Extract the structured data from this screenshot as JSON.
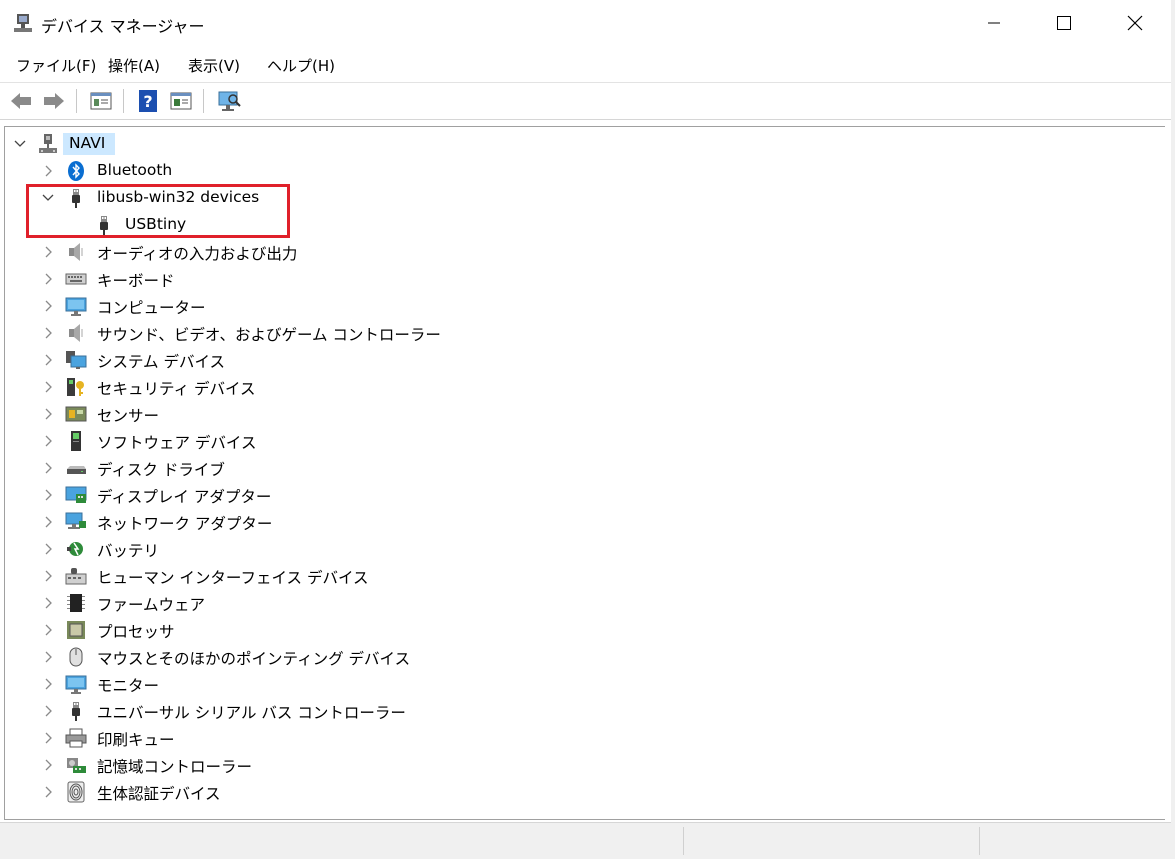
{
  "window": {
    "title": "デバイス マネージャー",
    "icon": "device-manager-icon"
  },
  "menu": [
    "ファイル(F)",
    "操作(A)",
    "表示(V)",
    "ヘルプ(H)"
  ],
  "toolbar": {
    "buttons": [
      "back-icon",
      "forward-icon",
      "properties-icon",
      "help-icon",
      "update-driver-icon",
      "scan-hardware-icon"
    ]
  },
  "tree": {
    "root": {
      "label": "NAVI",
      "icon": "computer-icon",
      "expanded": true,
      "selected": true
    },
    "items": [
      {
        "label": "Bluetooth",
        "icon": "bluetooth-icon",
        "expanded": false
      },
      {
        "label": "libusb-win32 devices",
        "icon": "usb-plug-icon",
        "expanded": true,
        "children": [
          {
            "label": "USBtiny",
            "icon": "usb-plug-icon"
          }
        ]
      },
      {
        "label": "オーディオの入力および出力",
        "icon": "speaker-icon",
        "expanded": false
      },
      {
        "label": "キーボード",
        "icon": "keyboard-icon",
        "expanded": false
      },
      {
        "label": "コンピューター",
        "icon": "monitor-icon",
        "expanded": false
      },
      {
        "label": "サウンド、ビデオ、およびゲーム コントローラー",
        "icon": "speaker-icon",
        "expanded": false
      },
      {
        "label": "システム デバイス",
        "icon": "system-devices-icon",
        "expanded": false
      },
      {
        "label": "セキュリティ デバイス",
        "icon": "security-key-icon",
        "expanded": false
      },
      {
        "label": "センサー",
        "icon": "sensor-icon",
        "expanded": false
      },
      {
        "label": "ソフトウェア デバイス",
        "icon": "software-device-icon",
        "expanded": false
      },
      {
        "label": "ディスク ドライブ",
        "icon": "disk-drive-icon",
        "expanded": false
      },
      {
        "label": "ディスプレイ アダプター",
        "icon": "display-adapter-icon",
        "expanded": false
      },
      {
        "label": "ネットワーク アダプター",
        "icon": "network-adapter-icon",
        "expanded": false
      },
      {
        "label": "バッテリ",
        "icon": "battery-icon",
        "expanded": false
      },
      {
        "label": "ヒューマン インターフェイス デバイス",
        "icon": "hid-icon",
        "expanded": false
      },
      {
        "label": "ファームウェア",
        "icon": "firmware-chip-icon",
        "expanded": false
      },
      {
        "label": "プロセッサ",
        "icon": "processor-icon",
        "expanded": false
      },
      {
        "label": "マウスとそのほかのポインティング デバイス",
        "icon": "mouse-icon",
        "expanded": false
      },
      {
        "label": "モニター",
        "icon": "monitor-icon",
        "expanded": false
      },
      {
        "label": "ユニバーサル シリアル バス コントローラー",
        "icon": "usb-plug-icon",
        "expanded": false
      },
      {
        "label": "印刷キュー",
        "icon": "printer-icon",
        "expanded": false
      },
      {
        "label": "記憶域コントローラー",
        "icon": "storage-controller-icon",
        "expanded": false
      },
      {
        "label": "生体認証デバイス",
        "icon": "fingerprint-icon",
        "expanded": false
      }
    ]
  },
  "colors": {
    "selection": "#cce8ff",
    "highlight_box": "#e0202a",
    "bluetooth": "#0a6ed1"
  }
}
